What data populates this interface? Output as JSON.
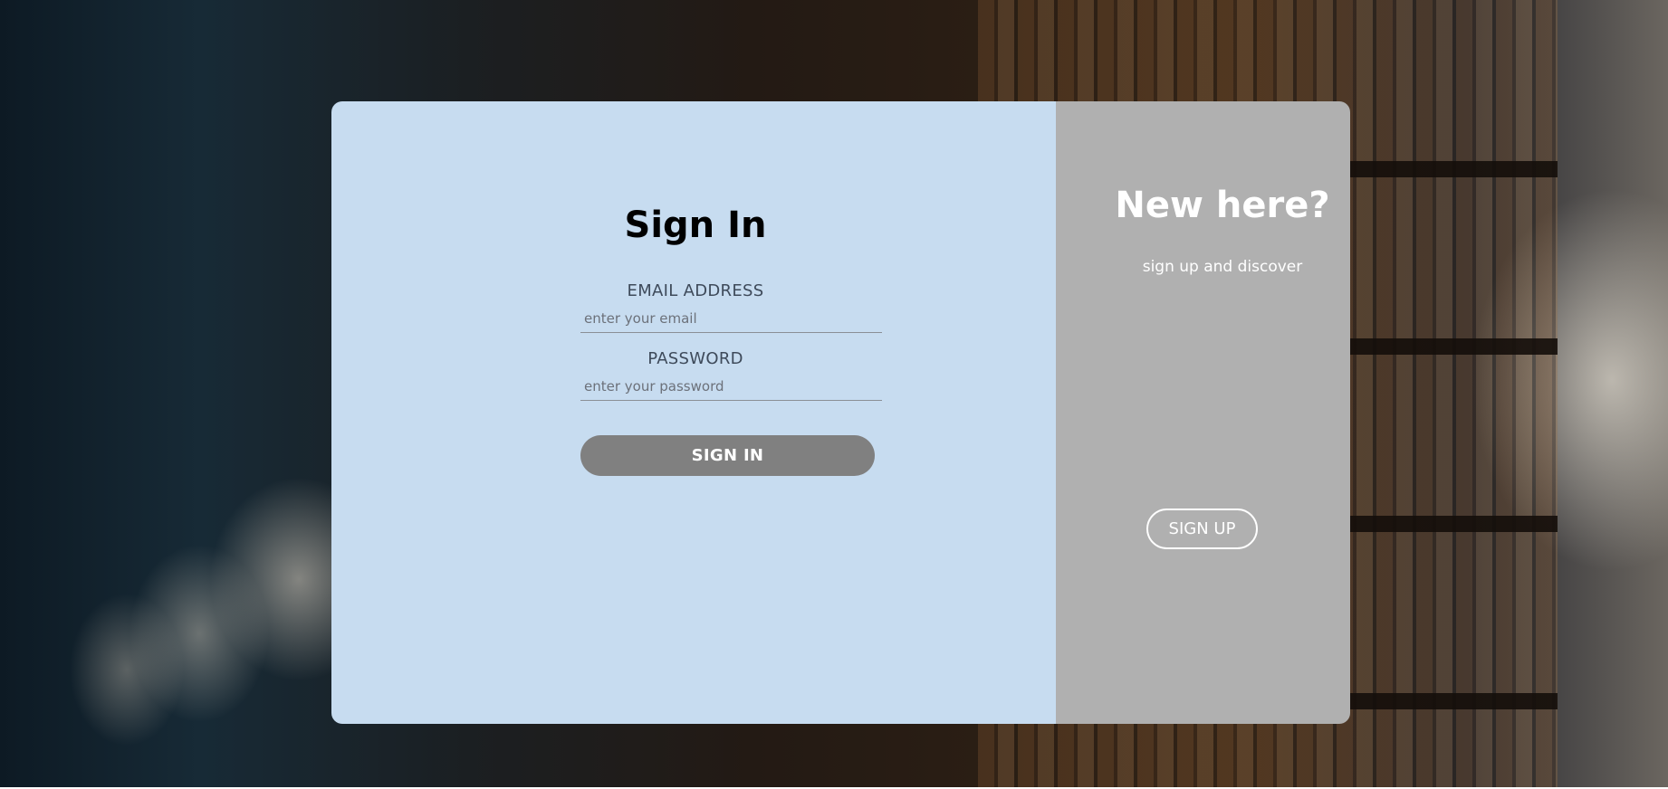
{
  "signin_panel": {
    "title": "Sign In",
    "email_label": "EMAIL ADDRESS",
    "email_placeholder": "enter your email",
    "email_value": "",
    "password_label": "PASSWORD",
    "password_placeholder": "enter your password",
    "password_value": "",
    "submit_label": "SIGN IN"
  },
  "signup_panel": {
    "title": "New here?",
    "subtitle": "sign up and discover",
    "button_label": "SIGN UP"
  },
  "colors": {
    "signin_panel_bg": "#c7dcf0",
    "signup_panel_bg": "#b0b0b0",
    "signin_button_bg": "#808080",
    "text_on_signup": "#ffffff"
  }
}
